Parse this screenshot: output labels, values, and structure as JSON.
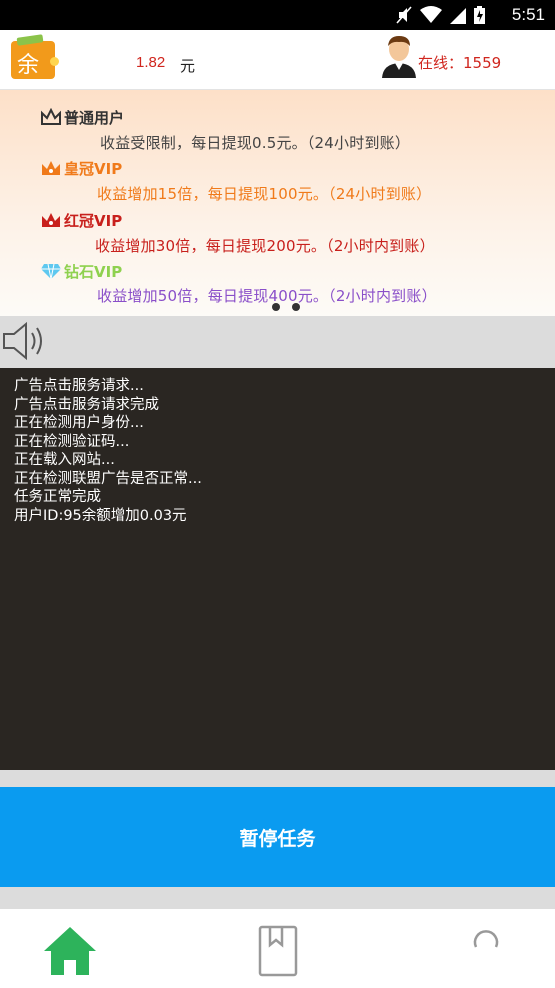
{
  "status_bar": {
    "time": "5:51",
    "icons": [
      "mute-icon",
      "wifi-icon",
      "signal-icon",
      "battery-icon"
    ]
  },
  "header": {
    "wallet_icon_char": "余",
    "balance": "1.82",
    "unit": "元",
    "online_label": "在线：1559"
  },
  "banner": {
    "tiers": [
      {
        "name": "普通用户",
        "desc": "收益受限制，每日提现0.5元。（24小时到账）",
        "color": "#333333",
        "icon": "crown-outline-icon"
      },
      {
        "name": "皇冠VIP",
        "desc": "收益增加15倍，每日提现100元。（24小时到账）",
        "color": "#f07a1a",
        "icon": "crown-orange-icon"
      },
      {
        "name": "红冠VIP",
        "desc": "收益增加30倍，每日提现200元。（2小时内到账）",
        "color": "#c8201c",
        "icon": "crown-red-icon"
      },
      {
        "name": "钻石VIP",
        "desc": "收益增加50倍，每日提现400元。（2小时内到账）",
        "color": "#8a4fc9",
        "icon": "diamond-icon"
      }
    ],
    "tier_name_colors": [
      "#333333",
      "#f07a1a",
      "#c8201c",
      "#8fd14f"
    ],
    "pager_dots": 2
  },
  "console": {
    "lines": [
      "广告点击服务请求...",
      "广告点击服务请求完成",
      "正在检测用户身份...",
      "正在检测验证码...",
      "正在载入网站...",
      "正在检测联盟广告是否正常...",
      "任务正常完成",
      "用户ID:95余额增加0.03元"
    ]
  },
  "pause_button": {
    "label": "暂停任务",
    "color": "#0a9bf0"
  },
  "bottom_nav": {
    "items": [
      {
        "icon": "home-icon",
        "active": true,
        "color": "#2db35b"
      },
      {
        "icon": "bookmark-icon",
        "active": false,
        "color": "#999999"
      },
      {
        "icon": "search-icon",
        "active": false,
        "color": "#999999"
      }
    ]
  }
}
